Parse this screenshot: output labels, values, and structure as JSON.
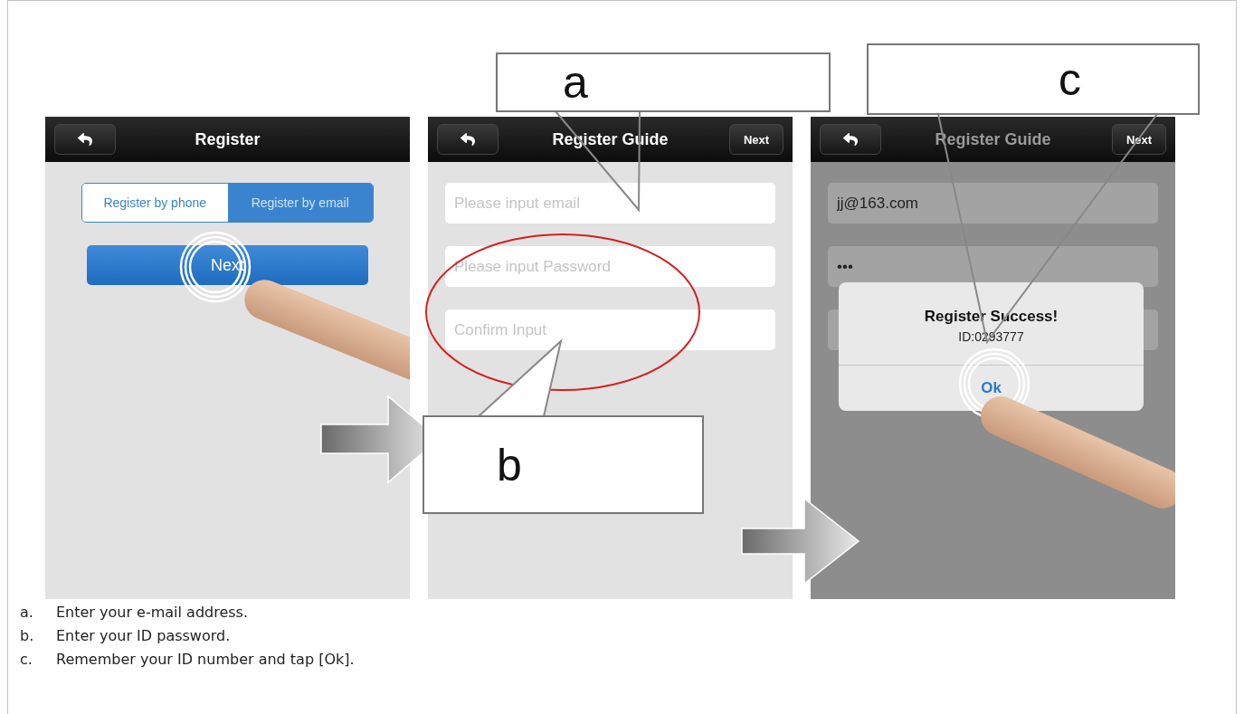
{
  "screens": [
    {
      "kind": "register",
      "title": "Register",
      "dimmed": false,
      "segments": [
        {
          "label": "Register by phone",
          "selected": false
        },
        {
          "label": "Register by email",
          "selected": true
        }
      ],
      "button": "Next"
    },
    {
      "kind": "guide",
      "title": "Register Guide",
      "dimmed": false,
      "next": "Next",
      "fields": [
        {
          "kind": "text",
          "placeholder": "Please input email"
        },
        {
          "kind": "text",
          "placeholder": "Please input Password"
        },
        {
          "kind": "text",
          "placeholder": "Confirm Input"
        }
      ]
    },
    {
      "kind": "guide",
      "title": "Register Guide",
      "dimmed": true,
      "next": "Next",
      "fields": [
        {
          "kind": "text",
          "value": "jj@163.com"
        },
        {
          "kind": "text",
          "value": "•••"
        },
        {
          "kind": "field"
        }
      ],
      "dialog": {
        "title": "Register Success!",
        "message": "ID:0293777",
        "button": "Ok"
      }
    }
  ],
  "callouts": [
    {
      "letter": "a"
    },
    {
      "letter": "b"
    },
    {
      "letter": "c"
    }
  ],
  "steps": [
    {
      "marker": "a.",
      "text": "Enter your e-mail address."
    },
    {
      "marker": "b.",
      "text": "Enter your ID password."
    },
    {
      "marker": "c.",
      "text": "Remember your ID number and tap [Ok]."
    }
  ]
}
